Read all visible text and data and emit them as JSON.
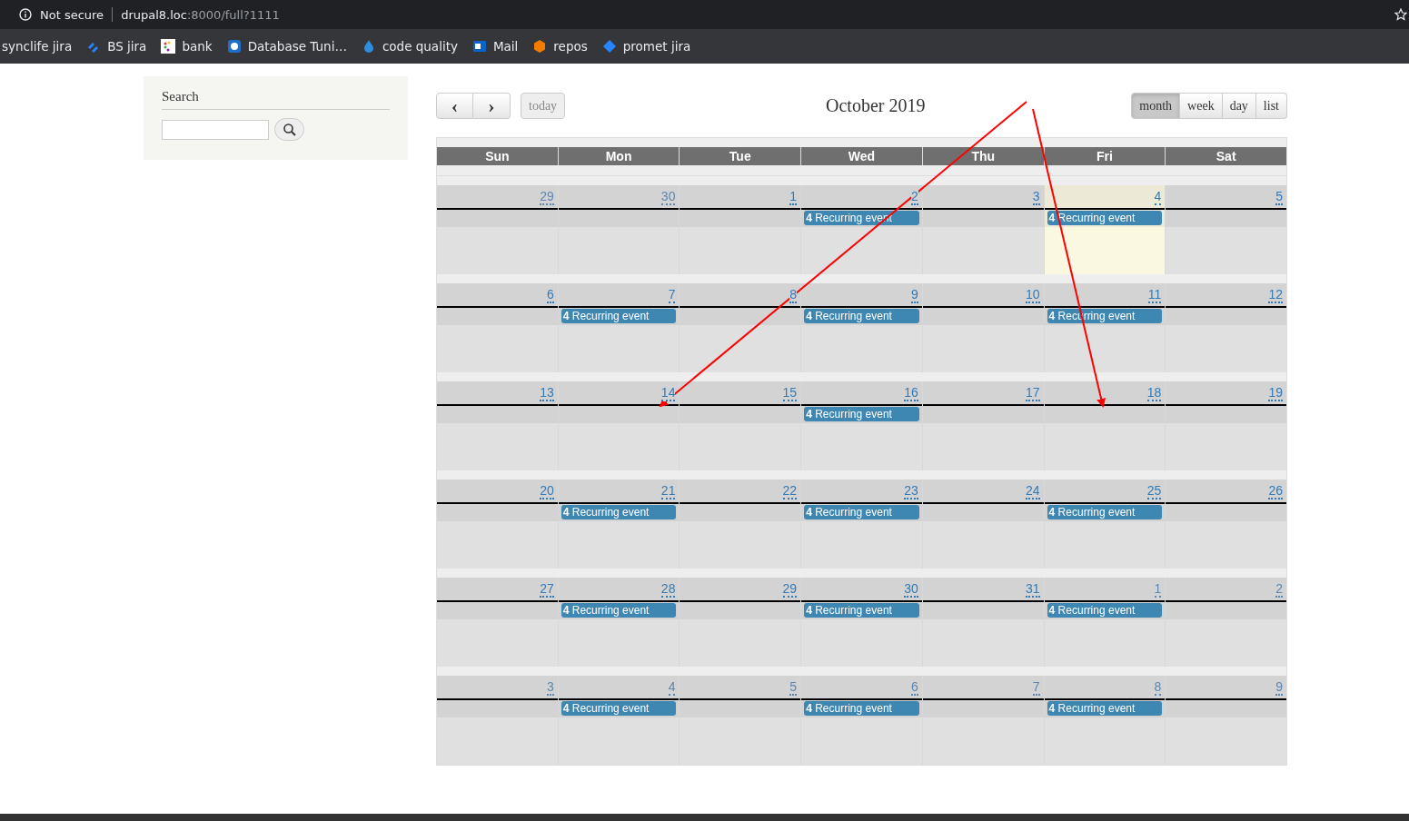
{
  "browser": {
    "security": "Not secure",
    "url_host": "drupal8.loc",
    "url_rest": ":8000/full?1111",
    "bookmarks": [
      {
        "label": "synclife jira",
        "kind": "none"
      },
      {
        "label": "BS jira",
        "kind": "jira"
      },
      {
        "label": "bank",
        "kind": "bank"
      },
      {
        "label": "Database Tuni…",
        "kind": "database"
      },
      {
        "label": "code quality",
        "kind": "drop"
      },
      {
        "label": "Mail",
        "kind": "mail"
      },
      {
        "label": "repos",
        "kind": "box"
      },
      {
        "label": "promet jira",
        "kind": "diamond"
      }
    ]
  },
  "sidebar": {
    "title": "Search"
  },
  "calendar": {
    "prev": "‹",
    "next": "›",
    "today": "today",
    "title": "October 2019",
    "views": [
      {
        "label": "month",
        "selected": true
      },
      {
        "label": "week",
        "selected": false
      },
      {
        "label": "day",
        "selected": false
      },
      {
        "label": "list",
        "selected": false
      }
    ],
    "weekdays": [
      "Sun",
      "Mon",
      "Tue",
      "Wed",
      "Thu",
      "Fri",
      "Sat"
    ],
    "weeks": [
      {
        "days": [
          {
            "number": "29",
            "other_month": true,
            "today": false
          },
          {
            "number": "30",
            "other_month": true,
            "today": false
          },
          {
            "number": "1",
            "other_month": false,
            "today": false
          },
          {
            "number": "2",
            "other_month": false,
            "today": false,
            "events": [
              {
                "time": "4",
                "title": "Recurring event"
              }
            ]
          },
          {
            "number": "3",
            "other_month": false,
            "today": false
          },
          {
            "number": "4",
            "other_month": false,
            "today": true,
            "events": [
              {
                "time": "4",
                "title": "Recurring event"
              }
            ]
          },
          {
            "number": "5",
            "other_month": false,
            "today": false
          }
        ]
      },
      {
        "days": [
          {
            "number": "6",
            "other_month": false,
            "today": false
          },
          {
            "number": "7",
            "other_month": false,
            "today": false,
            "events": [
              {
                "time": "4",
                "title": "Recurring event"
              }
            ]
          },
          {
            "number": "8",
            "other_month": false,
            "today": false
          },
          {
            "number": "9",
            "other_month": false,
            "today": false,
            "events": [
              {
                "time": "4",
                "title": "Recurring event"
              }
            ]
          },
          {
            "number": "10",
            "other_month": false,
            "today": false
          },
          {
            "number": "11",
            "other_month": false,
            "today": false,
            "events": [
              {
                "time": "4",
                "title": "Recurring event"
              }
            ]
          },
          {
            "number": "12",
            "other_month": false,
            "today": false
          }
        ]
      },
      {
        "days": [
          {
            "number": "13",
            "other_month": false,
            "today": false
          },
          {
            "number": "14",
            "other_month": false,
            "today": false
          },
          {
            "number": "15",
            "other_month": false,
            "today": false
          },
          {
            "number": "16",
            "other_month": false,
            "today": false,
            "events": [
              {
                "time": "4",
                "title": "Recurring event"
              }
            ]
          },
          {
            "number": "17",
            "other_month": false,
            "today": false
          },
          {
            "number": "18",
            "other_month": false,
            "today": false
          },
          {
            "number": "19",
            "other_month": false,
            "today": false
          }
        ]
      },
      {
        "days": [
          {
            "number": "20",
            "other_month": false,
            "today": false
          },
          {
            "number": "21",
            "other_month": false,
            "today": false,
            "events": [
              {
                "time": "4",
                "title": "Recurring event"
              }
            ]
          },
          {
            "number": "22",
            "other_month": false,
            "today": false
          },
          {
            "number": "23",
            "other_month": false,
            "today": false,
            "events": [
              {
                "time": "4",
                "title": "Recurring event"
              }
            ]
          },
          {
            "number": "24",
            "other_month": false,
            "today": false
          },
          {
            "number": "25",
            "other_month": false,
            "today": false,
            "events": [
              {
                "time": "4",
                "title": "Recurring event"
              }
            ]
          },
          {
            "number": "26",
            "other_month": false,
            "today": false
          }
        ]
      },
      {
        "days": [
          {
            "number": "27",
            "other_month": false,
            "today": false
          },
          {
            "number": "28",
            "other_month": false,
            "today": false,
            "events": [
              {
                "time": "4",
                "title": "Recurring event"
              }
            ]
          },
          {
            "number": "29",
            "other_month": false,
            "today": false
          },
          {
            "number": "30",
            "other_month": false,
            "today": false,
            "events": [
              {
                "time": "4",
                "title": "Recurring event"
              }
            ]
          },
          {
            "number": "31",
            "other_month": false,
            "today": false
          },
          {
            "number": "1",
            "other_month": true,
            "today": false,
            "events": [
              {
                "time": "4",
                "title": "Recurring event"
              }
            ]
          },
          {
            "number": "2",
            "other_month": true,
            "today": false
          }
        ]
      },
      {
        "days": [
          {
            "number": "3",
            "other_month": true,
            "today": false
          },
          {
            "number": "4",
            "other_month": true,
            "today": false,
            "events": [
              {
                "time": "4",
                "title": "Recurring event"
              }
            ]
          },
          {
            "number": "5",
            "other_month": true,
            "today": false
          },
          {
            "number": "6",
            "other_month": true,
            "today": false,
            "events": [
              {
                "time": "4",
                "title": "Recurring event"
              }
            ]
          },
          {
            "number": "7",
            "other_month": true,
            "today": false
          },
          {
            "number": "8",
            "other_month": true,
            "today": false,
            "events": [
              {
                "time": "4",
                "title": "Recurring event"
              }
            ]
          },
          {
            "number": "9",
            "other_month": true,
            "today": false
          }
        ]
      }
    ]
  }
}
